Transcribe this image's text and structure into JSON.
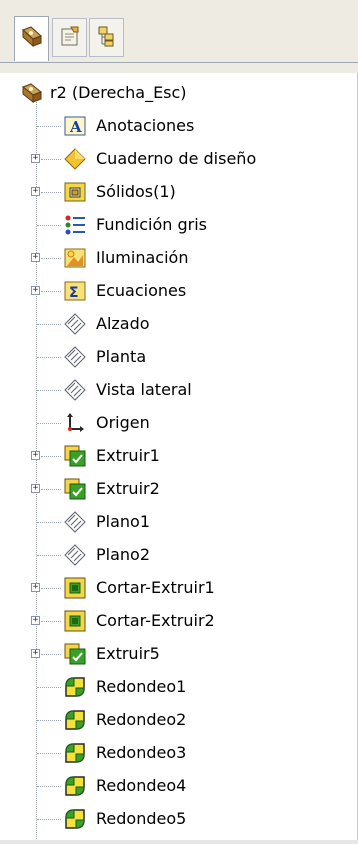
{
  "tabs": [
    {
      "name": "featuremanager-tab",
      "icon": "featuremanager-icon",
      "active": true
    },
    {
      "name": "propertymanager-tab",
      "icon": "propertymanager-icon",
      "active": false
    },
    {
      "name": "configurationmanager-tab",
      "icon": "configurationmanager-icon",
      "active": false
    }
  ],
  "tree": {
    "root_label": "r2  (Derecha_Esc)",
    "items": [
      {
        "label": "Anotaciones",
        "icon": "annotations-icon",
        "expandable": false
      },
      {
        "label": "Cuaderno de diseño",
        "icon": "design-binder-icon",
        "expandable": true
      },
      {
        "label": "Sólidos(1)",
        "icon": "solid-bodies-icon",
        "expandable": true
      },
      {
        "label": "Fundición gris",
        "icon": "material-icon",
        "expandable": false
      },
      {
        "label": "Iluminación",
        "icon": "lighting-icon",
        "expandable": true
      },
      {
        "label": "Ecuaciones",
        "icon": "equations-icon",
        "expandable": true
      },
      {
        "label": "Alzado",
        "icon": "plane-icon",
        "expandable": false
      },
      {
        "label": "Planta",
        "icon": "plane-icon",
        "expandable": false
      },
      {
        "label": "Vista lateral",
        "icon": "plane-icon",
        "expandable": false
      },
      {
        "label": "Origen",
        "icon": "origin-icon",
        "expandable": false
      },
      {
        "label": "Extruir1",
        "icon": "extrude-icon",
        "expandable": true
      },
      {
        "label": "Extruir2",
        "icon": "extrude-icon",
        "expandable": true
      },
      {
        "label": "Plano1",
        "icon": "plane-icon",
        "expandable": false
      },
      {
        "label": "Plano2",
        "icon": "plane-icon",
        "expandable": false
      },
      {
        "label": "Cortar-Extruir1",
        "icon": "cut-extrude-icon",
        "expandable": true
      },
      {
        "label": "Cortar-Extruir2",
        "icon": "cut-extrude-icon",
        "expandable": true
      },
      {
        "label": "Extruir5",
        "icon": "extrude-icon",
        "expandable": true
      },
      {
        "label": "Redondeo1",
        "icon": "fillet-icon",
        "expandable": false
      },
      {
        "label": "Redondeo2",
        "icon": "fillet-icon",
        "expandable": false
      },
      {
        "label": "Redondeo3",
        "icon": "fillet-icon",
        "expandable": false
      },
      {
        "label": "Redondeo4",
        "icon": "fillet-icon",
        "expandable": false
      },
      {
        "label": "Redondeo5",
        "icon": "fillet-icon",
        "expandable": false
      }
    ]
  },
  "colors": {
    "tab_bar": "#eeece2",
    "tree_connector": "#9aa3b0",
    "extrude_green": "#3aa02a",
    "fillet_yellow": "#f4e23a"
  }
}
